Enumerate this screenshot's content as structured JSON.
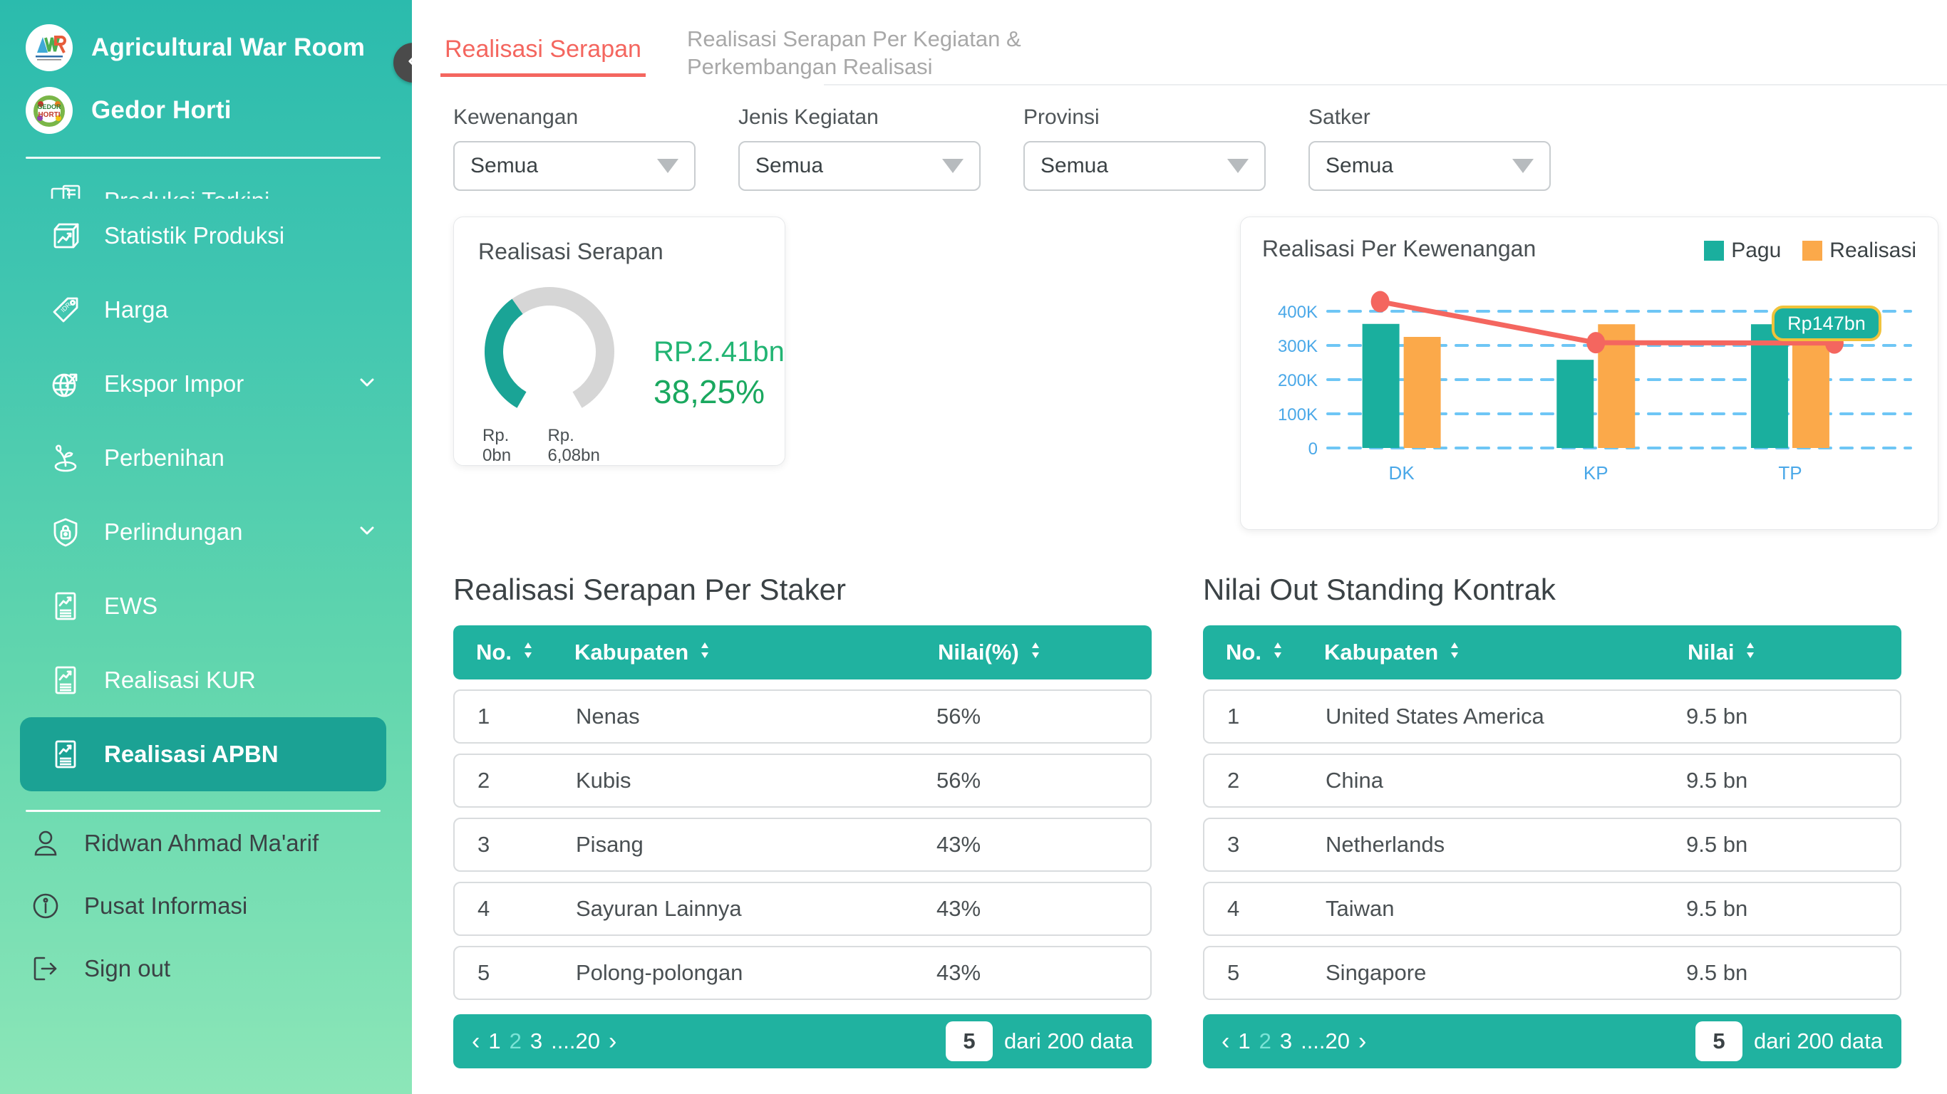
{
  "sidebar": {
    "brand": [
      {
        "logo": "awr-logo",
        "label": "Agricultural War Room"
      },
      {
        "logo": "gedor-horti-logo",
        "label": "Gedor Horti"
      }
    ],
    "nav": [
      {
        "icon": "news-icon",
        "label": "Produksi Terkini",
        "active": false,
        "expandable": false,
        "clipped": true
      },
      {
        "icon": "stats-box-icon",
        "label": "Statistik Produksi",
        "active": false,
        "expandable": false
      },
      {
        "icon": "price-tag-icon",
        "label": "Harga",
        "active": false,
        "expandable": false
      },
      {
        "icon": "globe-arrow-icon",
        "label": "Ekspor Impor",
        "active": false,
        "expandable": true
      },
      {
        "icon": "sprout-icon",
        "label": "Perbenihan",
        "active": false,
        "expandable": false
      },
      {
        "icon": "shield-lock-icon",
        "label": "Perlindungan",
        "active": false,
        "expandable": true
      },
      {
        "icon": "report-icon",
        "label": "EWS",
        "active": false,
        "expandable": false
      },
      {
        "icon": "report-icon",
        "label": "Realisasi KUR",
        "active": false,
        "expandable": false
      },
      {
        "icon": "report-icon",
        "label": "Realisasi APBN",
        "active": true,
        "expandable": false
      }
    ],
    "footer": [
      {
        "icon": "user-icon",
        "label": "Ridwan Ahmad Ma'arif"
      },
      {
        "icon": "info-icon",
        "label": "Pusat Informasi"
      },
      {
        "icon": "logout-icon",
        "label": "Sign out"
      }
    ],
    "collapse_icon": "chevron-left-icon"
  },
  "topbar": {
    "tab_label": "Realisasi Serapan",
    "title_line1": "Realisasi Serapan Per Kegiatan &",
    "title_line2": "Perkembangan Realisasi"
  },
  "filters": [
    {
      "label": "Kewenangan",
      "value": "Semua"
    },
    {
      "label": "Jenis Kegiatan",
      "value": "Semua"
    },
    {
      "label": "Provinsi",
      "value": "Semua"
    },
    {
      "label": "Satker",
      "value": "Semua"
    }
  ],
  "gauge_card": {
    "title": "Realisasi Serapan",
    "min_label": "Rp. 0bn",
    "max_label": "Rp. 6,08bn",
    "amount": "RP.2.41bn",
    "percent_label": "38,25%",
    "percent_value": 38.25,
    "arc_color": "#1aa496",
    "track_color": "#d6d6d6",
    "amount_color": "#22b473",
    "percent_color": "#1aa85f"
  },
  "chart_data": {
    "type": "bar",
    "title": "Realisasi Per Kewenangan",
    "xlabel": "",
    "ylabel": "",
    "categories": [
      "DK",
      "KP",
      "TP"
    ],
    "ylim": [
      0,
      450
    ],
    "yticks": [
      0,
      100,
      200,
      300,
      400
    ],
    "ytick_labels": [
      "0",
      "100K",
      "200K",
      "300K",
      "400K"
    ],
    "grid": true,
    "legend_position": "top-right",
    "series": [
      {
        "name": "Pagu",
        "color": "#1aaf9e",
        "values": [
          363,
          258,
          362
        ]
      },
      {
        "name": "Realisasi",
        "color": "#fba94a",
        "values": [
          325,
          362,
          330
        ]
      }
    ],
    "overlay_line": {
      "name": "trend",
      "color": "#f4665f",
      "values": [
        428,
        308,
        307
      ],
      "marker": "circle"
    },
    "annotation": {
      "text": "Rp147bn",
      "bg": "#1aaf9e",
      "border": "#f0c23a",
      "at_category": "TP"
    },
    "axis_label_color": "#4aa8e8",
    "grid_color": "#6ec6f5"
  },
  "table_left": {
    "title": "Realisasi Serapan Per Staker",
    "columns": [
      "No.",
      "Kabupaten",
      "Nilai(%)"
    ],
    "rows": [
      {
        "no": "1",
        "name": "Nenas",
        "value": "56%"
      },
      {
        "no": "2",
        "name": "Kubis",
        "value": "56%"
      },
      {
        "no": "3",
        "name": "Pisang",
        "value": "43%"
      },
      {
        "no": "4",
        "name": "Sayuran Lainnya",
        "value": "43%"
      },
      {
        "no": "5",
        "name": "Polong-polongan",
        "value": "43%"
      }
    ],
    "pager": {
      "prev": "‹",
      "next": "›",
      "pages": [
        "1",
        "2",
        "3",
        "....20"
      ],
      "per_page": "5",
      "total_text": "dari 200 data"
    }
  },
  "table_right": {
    "title": "Nilai Out Standing Kontrak",
    "columns": [
      "No.",
      "Kabupaten",
      "Nilai"
    ],
    "rows": [
      {
        "no": "1",
        "name": "United States America",
        "value": "9.5 bn"
      },
      {
        "no": "2",
        "name": "China",
        "value": "9.5 bn"
      },
      {
        "no": "3",
        "name": "Netherlands",
        "value": "9.5 bn"
      },
      {
        "no": "4",
        "name": "Taiwan",
        "value": "9.5 bn"
      },
      {
        "no": "5",
        "name": "Singapore",
        "value": "9.5 bn"
      }
    ],
    "pager": {
      "prev": "‹",
      "next": "›",
      "pages": [
        "1",
        "2",
        "3",
        "....20"
      ],
      "per_page": "5",
      "total_text": "dari 200 data"
    }
  },
  "theme": {
    "sidebar_top": "#2bbbad",
    "sidebar_bottom": "#8ce6b8",
    "active_item": "#1ba294",
    "accent_red": "#f4665f",
    "table_header": "#20b2a0"
  }
}
